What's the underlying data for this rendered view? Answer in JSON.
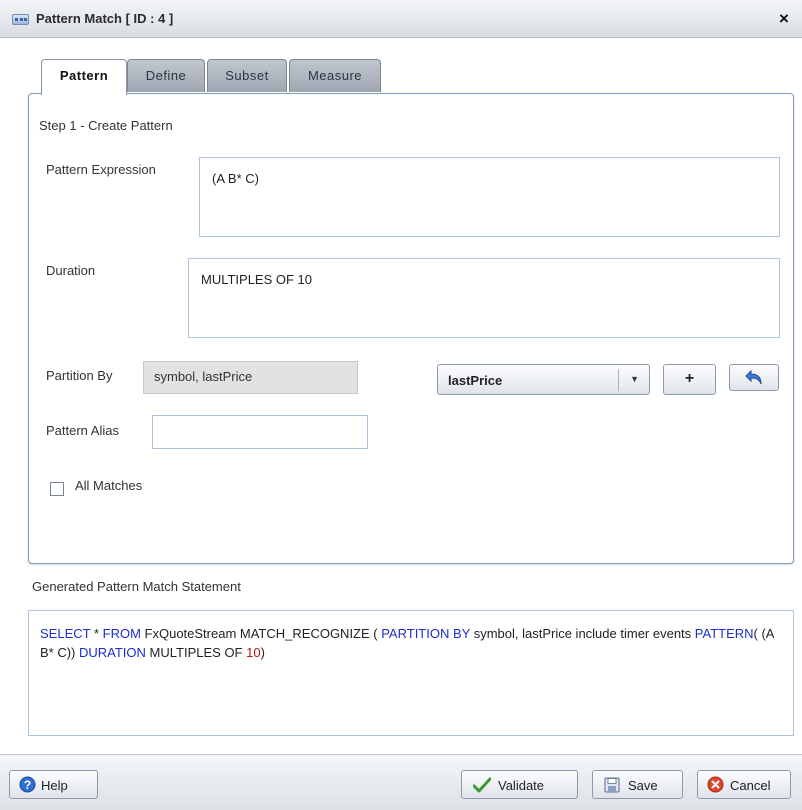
{
  "dialog": {
    "title": "Pattern Match [ ID : 4 ]",
    "close_symbol": "×",
    "icon": "window-app-icon"
  },
  "tabs": [
    {
      "label": "Pattern",
      "active": true
    },
    {
      "label": "Define",
      "active": false
    },
    {
      "label": "Subset",
      "active": false
    },
    {
      "label": "Measure",
      "active": false
    }
  ],
  "step": {
    "heading": "Step 1 - Create Pattern"
  },
  "pattern_expression": {
    "label": "Pattern Expression",
    "value": "(A B* C)"
  },
  "duration": {
    "label": "Duration",
    "value": "MULTIPLES OF 10"
  },
  "partition": {
    "label": "Partition By",
    "value": "symbol, lastPrice",
    "selected_attribute": "lastPrice",
    "add_label": "+",
    "undo_icon": "undo-arrow-icon"
  },
  "pattern_alias": {
    "label": "Pattern Alias",
    "value": ""
  },
  "all_matches": {
    "label": "All Matches",
    "checked": false
  },
  "generated": {
    "heading": "Generated Pattern Match Statement",
    "tokens": {
      "t1": "SELECT",
      "t2": " * ",
      "t3": "FROM",
      "t4": " FxQuoteStream  MATCH_RECOGNIZE ( ",
      "t5": "PARTITION BY",
      "t6": " symbol, lastPrice include timer events  ",
      "t7": "PATTERN",
      "t8": "( (A B* C)) ",
      "t9": "DURATION",
      "t10": " MULTIPLES OF ",
      "t11": "10",
      "t12": ")"
    },
    "colors": {
      "keyword": "#1a2fd1",
      "number": "#b21a1a"
    }
  },
  "footer": {
    "help_label": "Help",
    "validate_label": "Validate",
    "save_label": "Save",
    "cancel_label": "Cancel"
  }
}
